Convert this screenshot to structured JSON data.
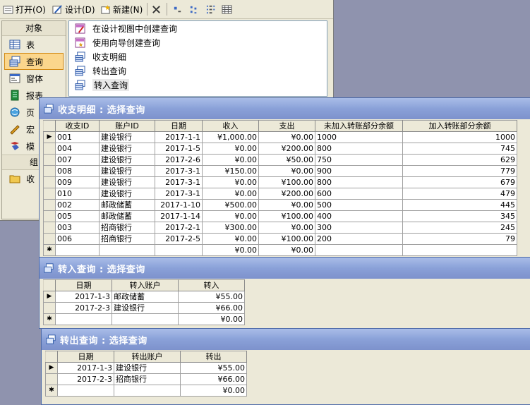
{
  "toolbar": {
    "open_label": "打开(O)",
    "design_label": "设计(D)",
    "new_label": "新建(N)"
  },
  "objects": {
    "header": "对象",
    "items": [
      {
        "label": "表",
        "icon": "table-icon"
      },
      {
        "label": "查询",
        "icon": "query-icon"
      },
      {
        "label": "窗体",
        "icon": "form-icon"
      },
      {
        "label": "报表",
        "icon": "report-icon"
      },
      {
        "label": "页",
        "icon": "page-icon"
      },
      {
        "label": "宏",
        "icon": "macro-icon"
      },
      {
        "label": "模",
        "icon": "module-icon"
      }
    ],
    "groups_header": "组",
    "group_item": "收"
  },
  "query_list": [
    {
      "label": "在设计视图中创建查询",
      "icon": "design-wizard-icon"
    },
    {
      "label": "使用向导创建查询",
      "icon": "wizard-icon"
    },
    {
      "label": "收支明细",
      "icon": "query-icon"
    },
    {
      "label": "转出查询",
      "icon": "query-icon"
    },
    {
      "label": "转入查询",
      "icon": "query-icon"
    }
  ],
  "income_query": {
    "title": "收支明细 : 选择查询",
    "columns": [
      "收支ID",
      "账户ID",
      "日期",
      "收入",
      "支出",
      "未加入转账部分余额",
      "加入转账部分余额"
    ],
    "rows": [
      [
        "001",
        "建设银行",
        "2017-1-1",
        "¥1,000.00",
        "¥0.00",
        "1000",
        "1000"
      ],
      [
        "004",
        "建设银行",
        "2017-1-5",
        "¥0.00",
        "¥200.00",
        "800",
        "745"
      ],
      [
        "007",
        "建设银行",
        "2017-2-6",
        "¥0.00",
        "¥50.00",
        "750",
        "629"
      ],
      [
        "008",
        "建设银行",
        "2017-3-1",
        "¥150.00",
        "¥0.00",
        "900",
        "779"
      ],
      [
        "009",
        "建设银行",
        "2017-3-1",
        "¥0.00",
        "¥100.00",
        "800",
        "679"
      ],
      [
        "010",
        "建设银行",
        "2017-3-1",
        "¥0.00",
        "¥200.00",
        "600",
        "479"
      ],
      [
        "002",
        "邮政储蓄",
        "2017-1-10",
        "¥500.00",
        "¥0.00",
        "500",
        "445"
      ],
      [
        "005",
        "邮政储蓄",
        "2017-1-14",
        "¥0.00",
        "¥100.00",
        "400",
        "345"
      ],
      [
        "003",
        "招商银行",
        "2017-2-1",
        "¥300.00",
        "¥0.00",
        "300",
        "245"
      ],
      [
        "006",
        "招商银行",
        "2017-2-5",
        "¥0.00",
        "¥100.00",
        "200",
        "79"
      ]
    ],
    "new_row": [
      "",
      "",
      "",
      "¥0.00",
      "¥0.00",
      "",
      ""
    ]
  },
  "transfer_in_query": {
    "title": "转入查询 : 选择查询",
    "columns": [
      "日期",
      "转入账户",
      "转入"
    ],
    "rows": [
      [
        "2017-1-3",
        "邮政储蓄",
        "¥55.00"
      ],
      [
        "2017-2-3",
        "建设银行",
        "¥66.00"
      ]
    ],
    "new_row": [
      "",
      "",
      "¥0.00"
    ]
  },
  "transfer_out_query": {
    "title": "转出查询 : 选择查询",
    "columns": [
      "日期",
      "转出账户",
      "转出"
    ],
    "rows": [
      [
        "2017-1-3",
        "建设银行",
        "¥55.00"
      ],
      [
        "2017-2-3",
        "招商银行",
        "¥66.00"
      ]
    ],
    "new_row": [
      "",
      "",
      "¥0.00"
    ]
  },
  "record_markers": {
    "current": "▶",
    "new": "✱"
  }
}
